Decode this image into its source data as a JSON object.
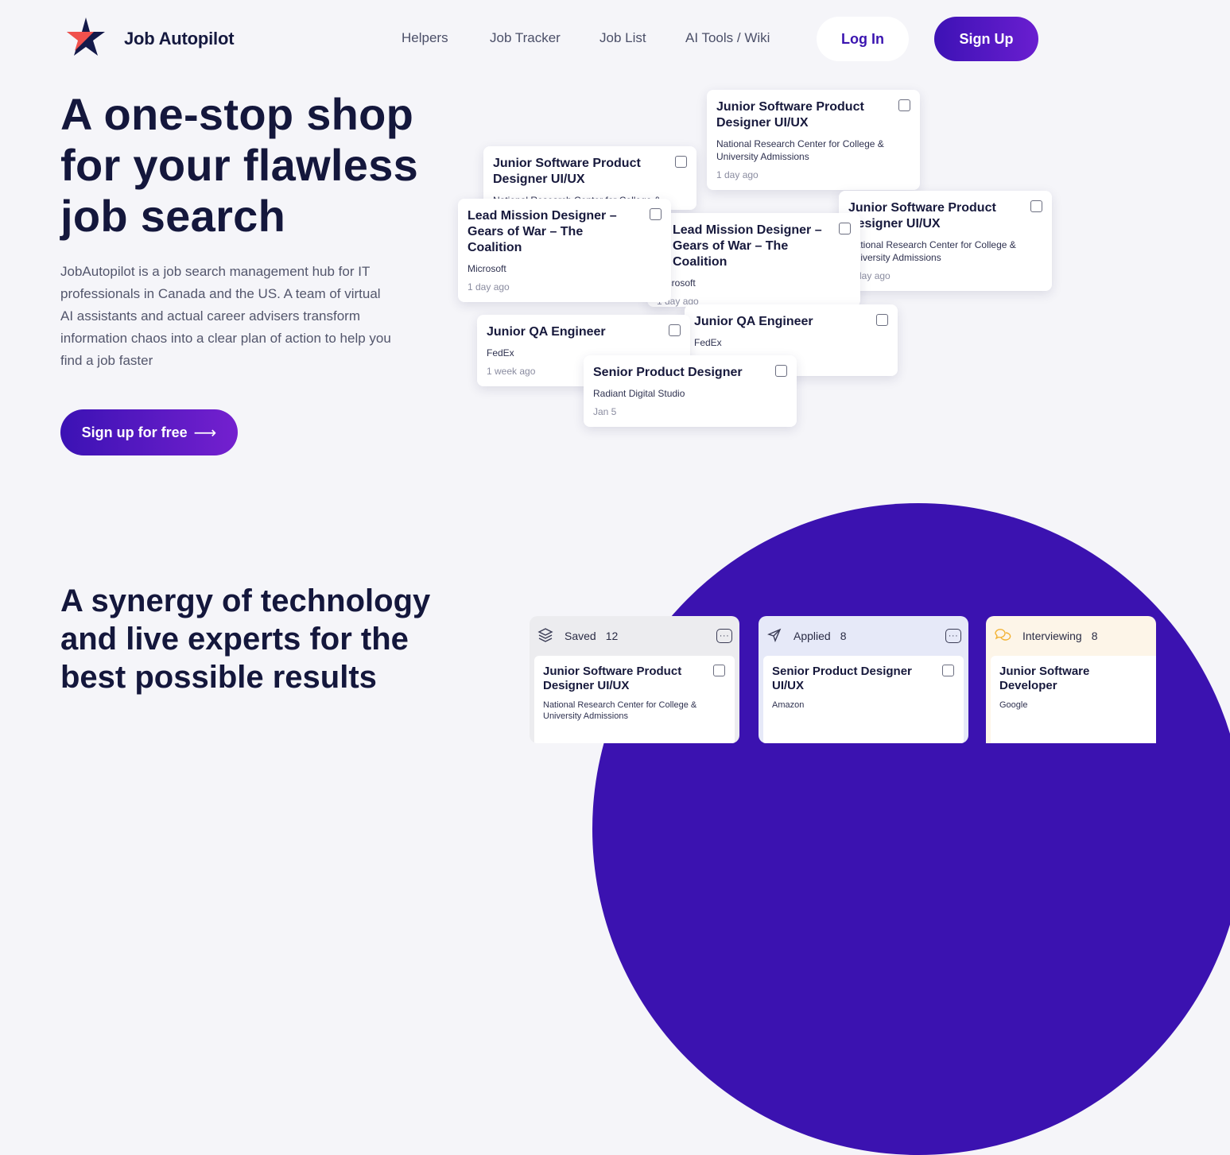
{
  "brand": {
    "name": "Job Autopilot",
    "accent": "#3b12b0",
    "star_colors": [
      "#f0514d",
      "#13194a"
    ]
  },
  "nav": {
    "items": [
      "Helpers",
      "Job Tracker",
      "Job List",
      "AI Tools / Wiki"
    ]
  },
  "auth": {
    "login_label": "Log In",
    "signup_label": "Sign Up"
  },
  "hero": {
    "title": "A one-stop shop for your flawless job search",
    "description": "JobAutopilot is a job search management hub for IT professionals in Canada and the US. A team of virtual AI assistants and actual career advisers transform information chaos into a clear plan of action to help you find a job faster",
    "cta_label": "Sign up for free",
    "cta_icon": "arrow-right-icon"
  },
  "job_cards": [
    {
      "title": "Junior Software Product Designer UI/UX",
      "company": "National Research Center for College & University Admissions",
      "date": ""
    },
    {
      "title": "Junior Software Product Designer UI/UX",
      "company": "National Research Center for College & University Admissions",
      "date": "1 day ago"
    },
    {
      "title": "Junior Software Product Designer UI/UX",
      "company": "National Research Center for College & University Admissions",
      "date": "1 day ago"
    },
    {
      "title": "Lead Mission Designer – Gears of War – The Coalition",
      "company": "Microsoft",
      "date": "1 day ago"
    },
    {
      "title": "Lead Mission Designer – Gears of War – The Coalition",
      "company": "Microsoft",
      "date": "1 day ago"
    },
    {
      "title": "Junior QA Engineer",
      "company": "FedEx",
      "date": "1 week ago"
    },
    {
      "title": "Junior QA Engineer",
      "company": "FedEx",
      "date": ""
    },
    {
      "title": "Senior Product Designer",
      "company": "Radiant Digital Studio",
      "date": "Jan 5"
    }
  ],
  "section2": {
    "title": "A synergy of technology and live experts for the best possible results"
  },
  "board": {
    "columns": [
      {
        "name": "Saved",
        "count": "12",
        "icon": "layers-icon",
        "bg": "#ececef",
        "card": {
          "title": "Junior Software Product Designer UI/UX",
          "company": "National Research Center for College & University Admissions"
        }
      },
      {
        "name": "Applied",
        "count": "8",
        "icon": "send-icon",
        "bg": "#e6e9f8",
        "card": {
          "title": "Senior Product Designer UI/UX",
          "company": "Amazon"
        }
      },
      {
        "name": "Interviewing",
        "count": "8",
        "icon": "chat-bubbles-icon",
        "bg": "#fdf5e8",
        "card": {
          "title": "Junior Software Developer",
          "company": "Google"
        }
      }
    ]
  }
}
